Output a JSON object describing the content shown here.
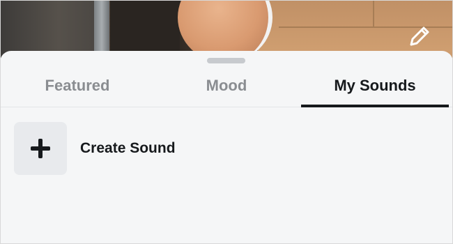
{
  "tabs": [
    {
      "label": "Featured",
      "active": false
    },
    {
      "label": "Mood",
      "active": false
    },
    {
      "label": "My Sounds",
      "active": true
    }
  ],
  "create_sound": {
    "label": "Create Sound",
    "icon": "plus-icon"
  },
  "preview": {
    "edit_icon": "pencil-icon"
  },
  "colors": {
    "sheet_background": "#f5f6f7",
    "active_tab": "#16191c",
    "inactive_tab": "#8a8d91",
    "tile_background": "#e8eaed"
  }
}
